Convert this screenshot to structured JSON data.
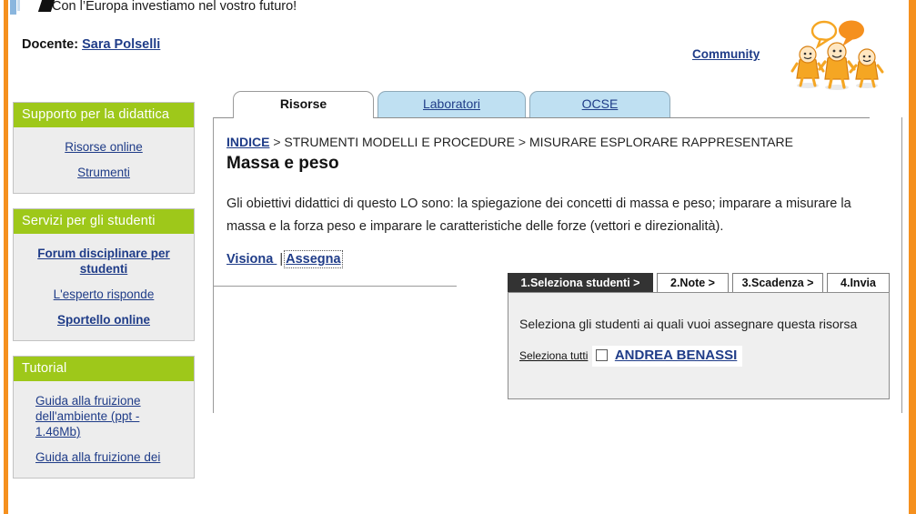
{
  "header": {
    "eu_slogan": "Con l’Europa investiamo nel vostro futuro!",
    "docente_label": "Docente:",
    "teacher_name": "Sara Polselli",
    "community_label": "Community"
  },
  "sidebar": {
    "boxes": [
      {
        "title": "Supporto per la didattica",
        "links": [
          {
            "label": "Risorse online",
            "bold": false
          },
          {
            "label": "Strumenti",
            "bold": false
          }
        ]
      },
      {
        "title": "Servizi per gli studenti",
        "links": [
          {
            "label": "Forum disciplinare per studenti",
            "bold": true
          },
          {
            "label": "L'esperto risponde",
            "bold": false
          },
          {
            "label": "Sportello online",
            "bold": true
          }
        ]
      },
      {
        "title": "Tutorial",
        "links": [
          {
            "label": "Guida alla fruizione dell'ambiente (ppt - 1.46Mb)",
            "bold": false
          },
          {
            "label": "Guida alla fruizione dei",
            "bold": false
          }
        ]
      }
    ]
  },
  "tabs": [
    {
      "label": "Risorse",
      "active": true
    },
    {
      "label": "Laboratori",
      "active": false
    },
    {
      "label": "OCSE",
      "active": false
    }
  ],
  "content": {
    "breadcrumb_root": "INDICE",
    "breadcrumb_sep1": " > ",
    "breadcrumb_level1": "STRUMENTI MODELLI E PROCEDURE",
    "breadcrumb_sep2": " > ",
    "breadcrumb_level2": "MISURARE ESPLORARE RAPPRESENTARE",
    "title": "Massa e peso",
    "description": "Gli obiettivi didattici di questo LO sono: la spiegazione dei concetti di massa e peso; imparare a misurare la massa e la forza peso e imparare le caratteristiche delle forze (vettori e direzionalità).",
    "action_view": "Visiona ",
    "action_separator": "|",
    "action_assign": "Assegna"
  },
  "wizard": {
    "steps": [
      {
        "label": "1.Seleziona studenti >",
        "current": true
      },
      {
        "label": "2.Note >",
        "current": false
      },
      {
        "label": "3.Scadenza >",
        "current": false
      },
      {
        "label": "4.Invia",
        "current": false
      }
    ],
    "instruction": "Seleziona gli studenti ai quali vuoi assegnare questa risorsa",
    "select_all_label": "Seleziona tutti",
    "students": [
      {
        "name": "ANDREA BENASSI",
        "checked": false
      }
    ]
  },
  "colors": {
    "orange_frame": "#f5901e",
    "sidebar_header_green": "#9ec81a",
    "tab_blue": "#bfe0f2",
    "link_blue": "#1f3c88",
    "wizard_current_step": "#333333",
    "panel_gray": "#efefef"
  }
}
